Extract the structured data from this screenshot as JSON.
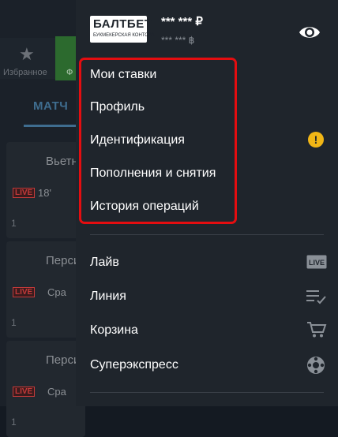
{
  "background": {
    "favorites_label": "Избранное",
    "green_tab_label": "Ф",
    "match_tab": "МАТЧ",
    "cards": [
      {
        "title": "Вьетн",
        "live": "LIVE",
        "minute": "18'",
        "odd": "1"
      },
      {
        "title": "Персик",
        "live": "LIVE",
        "minute": "Сра",
        "odd": "1"
      },
      {
        "title": "Персик",
        "live": "LIVE",
        "minute": "Сра",
        "odd": "1"
      }
    ]
  },
  "drawer": {
    "logo": {
      "brand": "БАЛТБЕТ",
      "sub": "БУКМЕКЕРСКАЯ КОНТОРА"
    },
    "balance_main": "*** *** ₽",
    "balance_bonus": "*** *** ฿",
    "account_menu": [
      "Мои ставки",
      "Профиль",
      "Идентификация",
      "Пополнения и снятия",
      "История операций"
    ],
    "identification_badge": "!",
    "sections_menu": [
      {
        "label": "Лайв",
        "icon": "live-icon",
        "icon_text": "LIVE"
      },
      {
        "label": "Линия",
        "icon": "line-list-icon"
      },
      {
        "label": "Корзина",
        "icon": "cart-icon"
      },
      {
        "label": "Суперэкспресс",
        "icon": "superexpress-icon"
      }
    ]
  },
  "colors": {
    "highlight": "#e40d10",
    "warning": "#f1b616",
    "drawer_bg": "#1f252c"
  }
}
